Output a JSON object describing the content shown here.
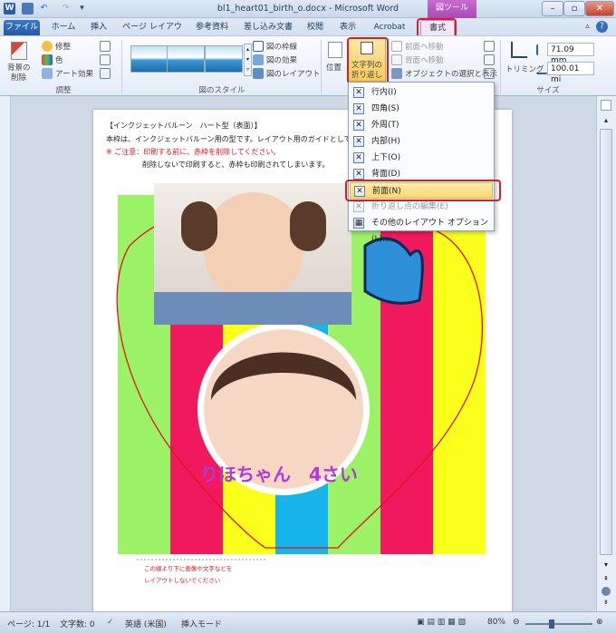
{
  "window": {
    "title": "bl1_heart01_birth_o.docx - Microsoft Word",
    "context_group": "図ツール",
    "app_icon": "W"
  },
  "tabs": [
    "ファイル",
    "ホーム",
    "挿入",
    "ページ レイアウト",
    "参考資料",
    "差し込み文書",
    "校閲",
    "表示",
    "Acrobat",
    "書式"
  ],
  "ribbon": {
    "adjust": {
      "remove_bg_line1": "背景の",
      "remove_bg_line2": "削除",
      "corrections": "修整",
      "color": "色",
      "artistic": "アート効果",
      "label": "調整"
    },
    "styles": {
      "border": "図の枠線",
      "effects": "図の効果",
      "layout": "図のレイアウト",
      "label": "図のスタイル"
    },
    "arrange": {
      "position": "位置",
      "wrap_line1": "文字列の",
      "wrap_line2": "折り返し",
      "bring_forward": "前面へ移動",
      "send_backward": "背面へ移動",
      "selection_pane": "オブジェクトの選択と表示"
    },
    "size": {
      "crop": "トリミング",
      "height": "71.09 mm",
      "width": "100.01 mi",
      "label": "サイズ"
    }
  },
  "wrap_menu": {
    "items": [
      {
        "label": "行内(I)",
        "disabled": false,
        "highlighted": false
      },
      {
        "label": "四角(S)",
        "disabled": false,
        "highlighted": false
      },
      {
        "label": "外周(T)",
        "disabled": false,
        "highlighted": false
      },
      {
        "label": "内部(H)",
        "disabled": false,
        "highlighted": false
      },
      {
        "label": "上下(O)",
        "disabled": false,
        "highlighted": false
      },
      {
        "label": "背面(D)",
        "disabled": false,
        "highlighted": false
      },
      {
        "label": "前面(N)",
        "disabled": false,
        "highlighted": true
      },
      {
        "label": "折り返し点の編集(E)",
        "disabled": true,
        "highlighted": false
      },
      {
        "label": "その他のレイアウト オプション(L)...",
        "disabled": false,
        "highlighted": false
      }
    ]
  },
  "document": {
    "line1": "【インクジェットバルーン　ハート型（表面）】",
    "line2": "本枠は、インクジェットバルーン用の型です。レイアウト用のガイドとして、",
    "line3": "※ ご注意：印刷する前に、赤枠を削除してください。",
    "line4": "削除しないで印刷すると、赤枠も印刷されてしまいます。",
    "caption": "りほちゃん　4さい",
    "footnote1": "この線より下に画像や文字などを",
    "footnote2": "レイアウトしないでください"
  },
  "status_bar": {
    "page": "ページ: 1/1",
    "words": "文字数: 0",
    "language": "英語 (米国)",
    "mode": "挿入モード",
    "zoom": "80%"
  },
  "colors": {
    "stripe_green": "#9cf266",
    "stripe_pink": "#f0195e",
    "stripe_yellow": "#fbff1c",
    "stripe_blue": "#17b4ec",
    "highlight_red": "#d21f2a",
    "caption_purple": "#b03ad8"
  }
}
